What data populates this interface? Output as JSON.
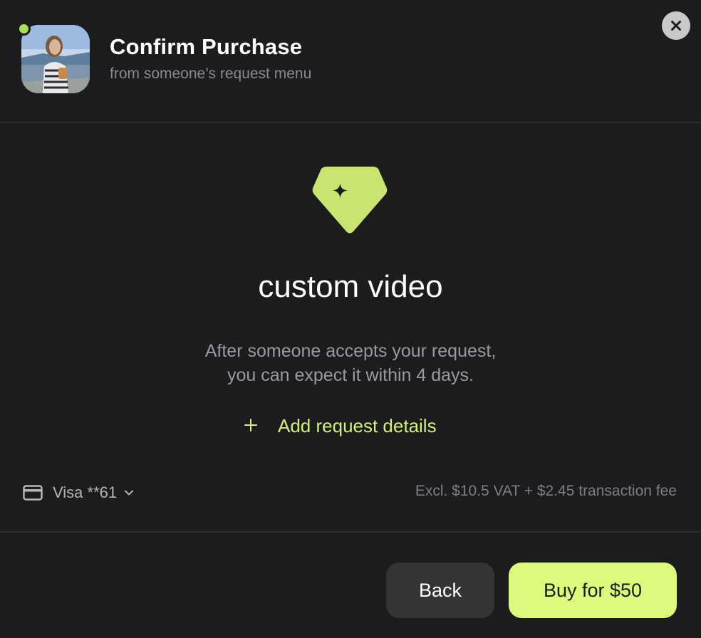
{
  "header": {
    "title": "Confirm Purchase",
    "subtitle": "from someone’s request menu"
  },
  "product": {
    "icon": "gem-sparkle-icon",
    "name": "custom video",
    "description_line1": "After someone accepts your request,",
    "description_line2": "you can expect it within 4 days."
  },
  "add_details": {
    "icon": "plus-icon",
    "label": "Add request details"
  },
  "payment": {
    "icon": "credit-card-icon",
    "method_label": "Visa **61",
    "fee_text": "Excl. $10.5 VAT + $2.45 transaction fee"
  },
  "actions": {
    "back_label": "Back",
    "buy_label": "Buy for $50"
  },
  "colors": {
    "background": "#1c1c1e",
    "accent": "#dcfa7c",
    "accent_text": "#d4f07a",
    "online": "#a8e05a"
  }
}
